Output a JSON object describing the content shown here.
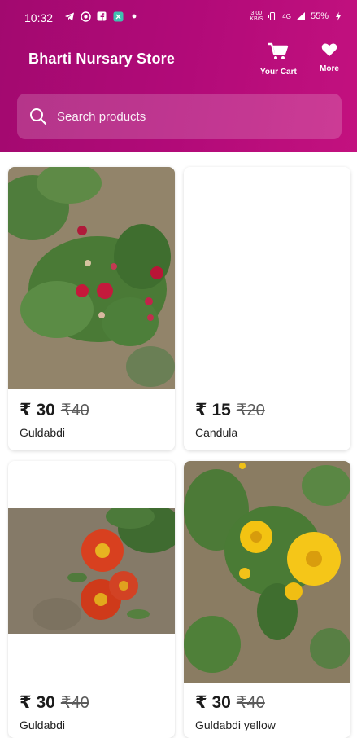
{
  "status_bar": {
    "time": "10:32",
    "speed_value": "3.00",
    "speed_unit": "KB/S",
    "network": "4G",
    "battery": "55%"
  },
  "header": {
    "title": "Bharti Nursary Store",
    "cart_label": "Your Cart",
    "more_label": "More"
  },
  "search": {
    "placeholder": "Search products"
  },
  "products": [
    {
      "price": "₹ 30",
      "mrp": "₹40",
      "name": "Guldabdi"
    },
    {
      "price": "₹ 15",
      "mrp": "₹20",
      "name": "Candula"
    },
    {
      "price": "₹ 30",
      "mrp": "₹40",
      "name": "Guldabdi"
    },
    {
      "price": "₹ 30",
      "mrp": "₹40",
      "name": "Guldabdi yellow"
    }
  ],
  "colors": {
    "header_start": "#a2096f",
    "header_end": "#c3117f",
    "text_primary": "#1b1b1b"
  }
}
